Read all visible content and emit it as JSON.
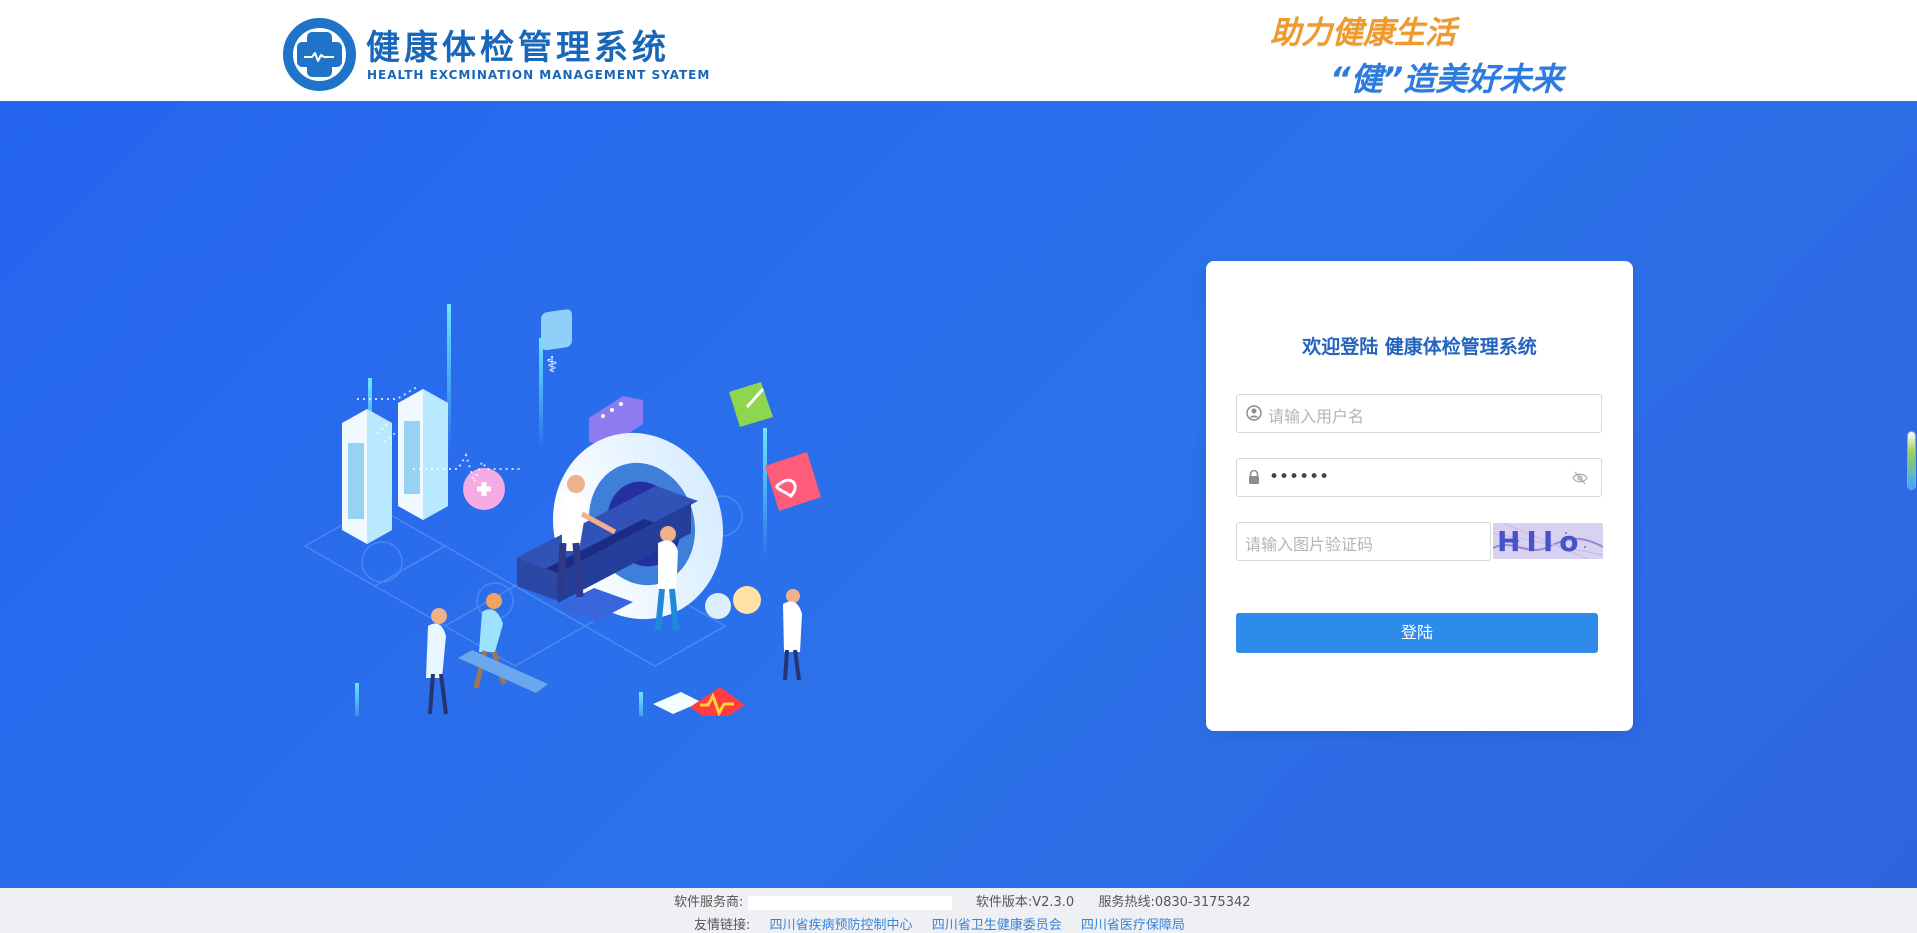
{
  "header": {
    "title_cn": "健康体检管理系统",
    "title_en": "HEALTH EXCMINATION MANAGEMENT SYATEM",
    "slogan_line1": "助力健康生活",
    "slogan_line2": "“健”造美好未来",
    "logo_icon": "medical-cross-pulse-icon"
  },
  "login": {
    "title": "欢迎登陆  健康体检管理系统",
    "username_placeholder": "请输入用户名",
    "password_value": "••••••",
    "captcha_placeholder": "请输入图片验证码",
    "captcha_text": "HIIo",
    "button_label": "登陆"
  },
  "footer": {
    "vendor_label": "软件服务商:",
    "version": "软件版本:V2.3.0",
    "hotline": "服务热线:0830-3175342",
    "links_label": "友情链接:",
    "links": [
      "四川省疾病预防控制中心",
      "四川省卫生健康委员会",
      "四川省医疗保障局"
    ]
  },
  "colors": {
    "brand_blue": "#1967b8",
    "hero_blue": "#2a6bea",
    "button_blue": "#2f8bea",
    "slogan_orange": "#ee9a2d"
  }
}
